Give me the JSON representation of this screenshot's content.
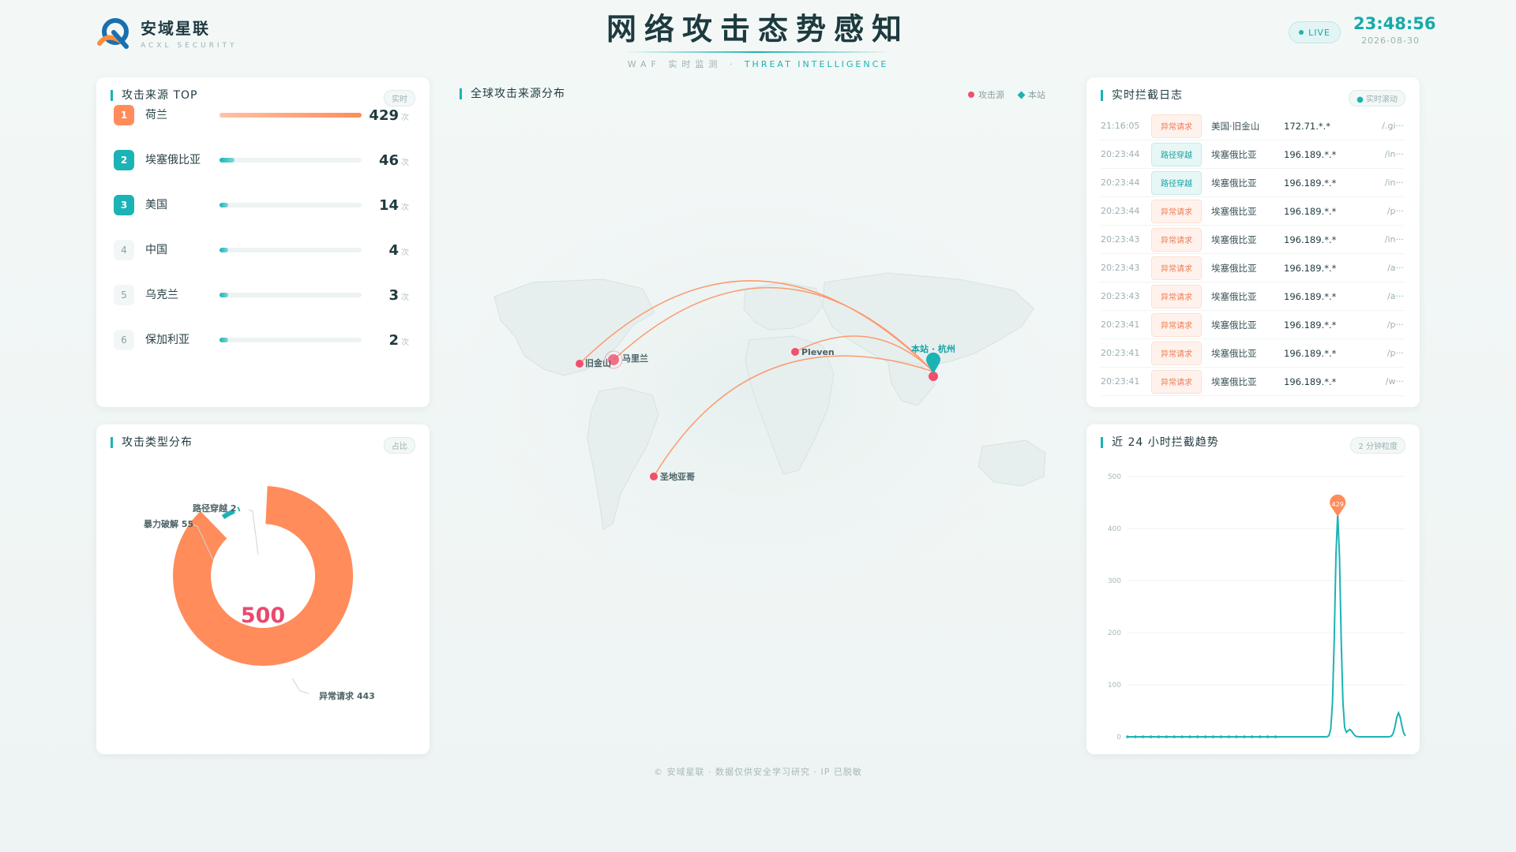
{
  "header": {
    "brand_name": "安域星联",
    "brand_sub": "ACXL SECURITY",
    "title": "网络攻击态势感知",
    "subtitle_left": "WAF 实时监测 ·",
    "subtitle_right": "THREAT INTELLIGENCE",
    "live_label": "LIVE",
    "time": "23:48:56",
    "date": "2026-08-30"
  },
  "colors": {
    "accent": "#1bb3b5",
    "orange": "#ff8c5a",
    "red": "#f0506c"
  },
  "top_sources": {
    "title": "攻击来源 TOP",
    "tag": "实时",
    "unit": "次",
    "items": [
      {
        "rank": "1",
        "name": "荷兰",
        "count": "429",
        "ratio": 1.0
      },
      {
        "rank": "2",
        "name": "埃塞俄比亚",
        "count": "46",
        "ratio": 0.107
      },
      {
        "rank": "3",
        "name": "美国",
        "count": "14",
        "ratio": 0.033
      },
      {
        "rank": "4",
        "name": "中国",
        "count": "4",
        "ratio": 0.01
      },
      {
        "rank": "5",
        "name": "乌克兰",
        "count": "3",
        "ratio": 0.007
      },
      {
        "rank": "6",
        "name": "保加利亚",
        "count": "2",
        "ratio": 0.005
      }
    ]
  },
  "attack_types": {
    "title": "攻击类型分布",
    "tag": "占比",
    "total": "500",
    "label_path": "路径穿越 2",
    "label_brute": "暴力破解 55",
    "label_anom": "异常请求 443"
  },
  "map": {
    "title": "全球攻击来源分布",
    "legend_source": "攻击源",
    "legend_site": "本站",
    "cities": {
      "sf": "旧金山",
      "mx": "马里兰",
      "pleven": "Pleven",
      "santiago": "圣地亚哥",
      "hangzhou": "本站 · 杭州"
    }
  },
  "log": {
    "title": "实时拦截日志",
    "tag": "实时滚动",
    "rows": [
      {
        "time": "21:16:05",
        "type": "异常请求",
        "kind": "anom",
        "src": "美国·旧金山",
        "ip": "172.71.*.*",
        "path": "/.gi···"
      },
      {
        "time": "20:23:44",
        "type": "路径穿越",
        "kind": "path",
        "src": "埃塞俄比亚",
        "ip": "196.189.*.*",
        "path": "/in···"
      },
      {
        "time": "20:23:44",
        "type": "路径穿越",
        "kind": "path",
        "src": "埃塞俄比亚",
        "ip": "196.189.*.*",
        "path": "/in···"
      },
      {
        "time": "20:23:44",
        "type": "异常请求",
        "kind": "anom",
        "src": "埃塞俄比亚",
        "ip": "196.189.*.*",
        "path": "/p···"
      },
      {
        "time": "20:23:43",
        "type": "异常请求",
        "kind": "anom",
        "src": "埃塞俄比亚",
        "ip": "196.189.*.*",
        "path": "/in···"
      },
      {
        "time": "20:23:43",
        "type": "异常请求",
        "kind": "anom",
        "src": "埃塞俄比亚",
        "ip": "196.189.*.*",
        "path": "/a···"
      },
      {
        "time": "20:23:43",
        "type": "异常请求",
        "kind": "anom",
        "src": "埃塞俄比亚",
        "ip": "196.189.*.*",
        "path": "/a···"
      },
      {
        "time": "20:23:41",
        "type": "异常请求",
        "kind": "anom",
        "src": "埃塞俄比亚",
        "ip": "196.189.*.*",
        "path": "/p···"
      },
      {
        "time": "20:23:41",
        "type": "异常请求",
        "kind": "anom",
        "src": "埃塞俄比亚",
        "ip": "196.189.*.*",
        "path": "/p···"
      },
      {
        "time": "20:23:41",
        "type": "异常请求",
        "kind": "anom",
        "src": "埃塞俄比亚",
        "ip": "196.189.*.*",
        "path": "/w···"
      }
    ]
  },
  "trend": {
    "title": "近 24 小时拦截趋势",
    "tag": "2 分钟粒度",
    "peak_label": "429"
  },
  "chart_data": [
    {
      "type": "pie",
      "labels": [
        "异常请求",
        "暴力破解",
        "路径穿越"
      ],
      "values": [
        443,
        55,
        2
      ],
      "total": 500
    },
    {
      "type": "line",
      "title": "近 24 小时拦截趋势",
      "ylim": [
        0,
        500
      ],
      "yticks": [
        0,
        100,
        200,
        300,
        400,
        500
      ],
      "grid": true,
      "x": [
        0,
        1,
        2,
        3,
        4,
        5,
        6,
        7,
        8,
        9,
        10,
        11,
        12,
        13,
        14,
        15,
        16,
        17,
        18,
        19,
        20,
        21,
        22,
        23,
        24,
        25,
        26,
        27,
        28,
        29,
        30,
        31,
        32,
        33,
        34,
        35,
        36,
        37,
        38
      ],
      "values": [
        0,
        0,
        0,
        0,
        0,
        0,
        0,
        0,
        0,
        0,
        0,
        0,
        0,
        0,
        0,
        0,
        0,
        0,
        0,
        0,
        0,
        0,
        0,
        0,
        0,
        0,
        0,
        0,
        0,
        0,
        0,
        0,
        0,
        0,
        0,
        0,
        0,
        0,
        0
      ]
    }
  ]
}
